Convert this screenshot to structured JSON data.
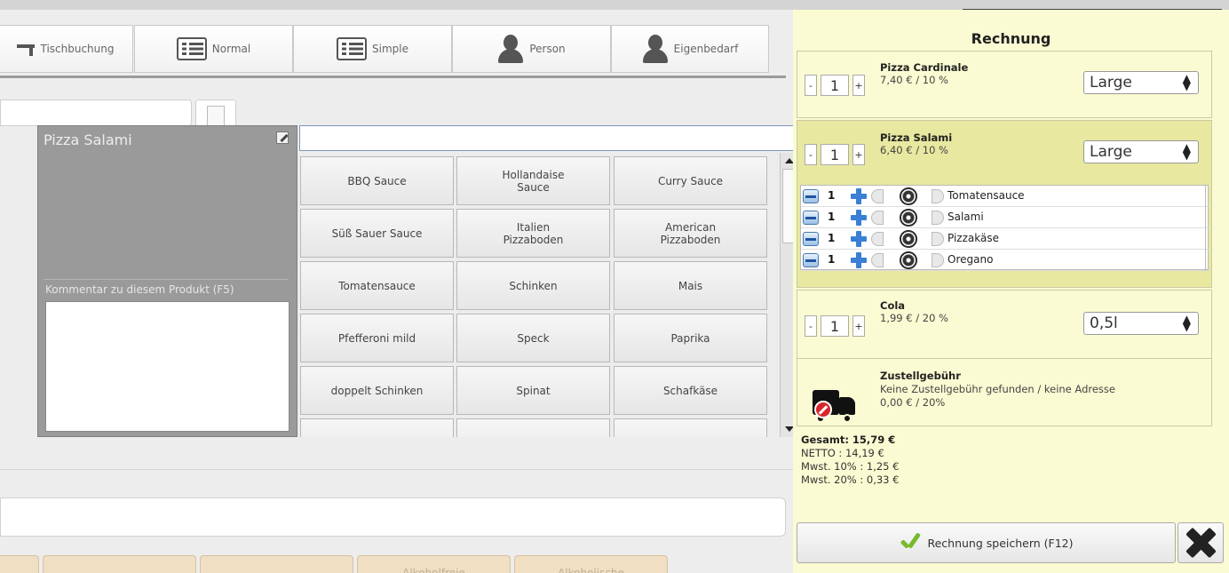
{
  "toolbar": {
    "buttons": [
      {
        "label": "Tischbuchung",
        "icon": "table-icon"
      },
      {
        "label": "Normal",
        "icon": "list-icon"
      },
      {
        "label": "Simple",
        "icon": "list-icon"
      },
      {
        "label": "Person",
        "icon": "person-icon"
      },
      {
        "label": "Eigenbedarf",
        "icon": "person-icon"
      }
    ]
  },
  "product_panel": {
    "title": "Pizza Salami",
    "comment_label": "Kommentar zu diesem Produkt (F5)",
    "comment_value": ""
  },
  "extras": {
    "search_value": "",
    "buttons": [
      "BBQ Sauce",
      "Hollandaise\nSauce",
      "Curry Sauce",
      "Süß Sauer Sauce",
      "Italien\nPizzaboden",
      "American\nPizzaboden",
      "Tomatensauce",
      "Schinken",
      "Mais",
      "Pfefferoni mild",
      "Speck",
      "Paprika",
      "doppelt Schinken",
      "Spinat",
      "Schafkäse",
      "",
      "",
      ""
    ]
  },
  "categories": [
    "",
    "",
    "",
    "Alkoholfreie",
    "Alkoholische"
  ],
  "invoice": {
    "title": "Rechnung",
    "items": [
      {
        "qty": "1",
        "name": "Pizza Cardinale",
        "price": "7,40 € / 10 %",
        "size": "Large"
      },
      {
        "qty": "1",
        "name": "Pizza Salami",
        "price": "6,40 € / 10 %",
        "size": "Large"
      },
      {
        "qty": "1",
        "name": "Cola",
        "price": "1,99 € / 20 %",
        "size": "0,5l"
      }
    ],
    "ingredients": [
      {
        "count": "1",
        "name": "Tomatensauce"
      },
      {
        "count": "1",
        "name": "Salami"
      },
      {
        "count": "1",
        "name": "Pizzakäse"
      },
      {
        "count": "1",
        "name": "Oregano"
      }
    ],
    "delivery": {
      "title": "Zustellgebühr",
      "note": "Keine Zustellgebühr gefunden / keine Adresse",
      "price": "0,00 € / 20%"
    },
    "totals": {
      "gesamt": "Gesamt: 15,79 €",
      "netto": "NETTO : 14,19 €",
      "mwst10": "Mwst. 10% : 1,25 €",
      "mwst20": "Mwst. 20% : 0,33 €"
    },
    "save_label": "Rechnung speichern (F12)"
  },
  "colors": {
    "invoice_bg": "#fbfbd3",
    "selected_item_bg": "#e8e8a0",
    "panel_gray": "#9a9a9a"
  }
}
